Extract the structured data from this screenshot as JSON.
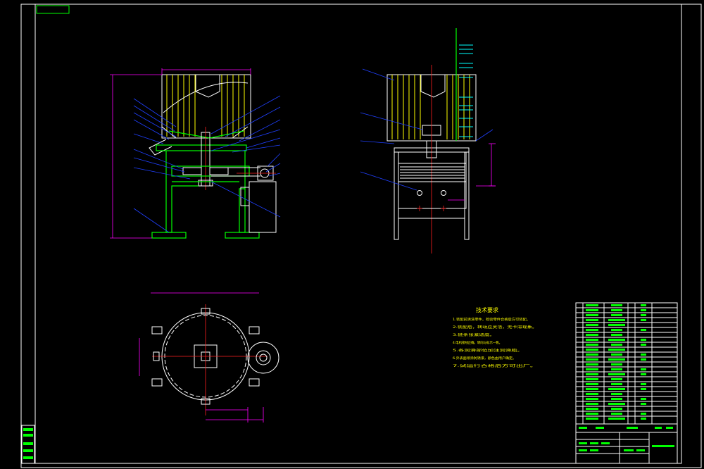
{
  "drawing": {
    "tech_requirements_title": "技术要求",
    "tech_requirements": [
      "1.装配前清洗零件，检验零件合格后方可装配。",
      "2.装配后，转动应灵活，无卡滞现象。",
      "3.链条张紧适度。",
      "4.电机接线正确，转向与标示一致。",
      "5.各润滑部位加注润滑脂。",
      "6.外表面喷涂防锈漆，颜色由用户确定。",
      "7.试运行合格后方可出厂。"
    ],
    "colors": {
      "background": "#000000",
      "frame": "#ffffff",
      "hopper": "#ffff00",
      "frame_parts": "#00ff00",
      "leaders": "#2040ff",
      "dimensions": "#ff00ff",
      "centerlines": "#ff2020",
      "annotation": "#00ffff"
    }
  }
}
